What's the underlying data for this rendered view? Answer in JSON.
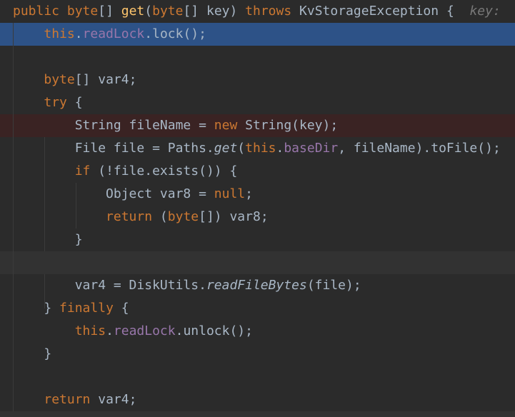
{
  "editor": {
    "lines": [
      {
        "indent": "",
        "tokens": [
          {
            "t": "public",
            "c": "kw"
          },
          {
            "t": " "
          },
          {
            "t": "byte",
            "c": "kw"
          },
          {
            "t": "[] "
          },
          {
            "t": "get",
            "c": "fn"
          },
          {
            "t": "("
          },
          {
            "t": "byte",
            "c": "kw"
          },
          {
            "t": "[] key) "
          },
          {
            "t": "throws",
            "c": "kw"
          },
          {
            "t": " KvStorageException {  "
          },
          {
            "t": "key:",
            "c": "hint"
          }
        ]
      },
      {
        "indent": "    ",
        "hl": "exec",
        "tokens": [
          {
            "t": "this",
            "c": "kw"
          },
          {
            "t": "."
          },
          {
            "t": "readLock",
            "c": "fld"
          },
          {
            "t": ".lock();"
          }
        ]
      },
      {
        "indent": "",
        "tokens": []
      },
      {
        "indent": "    ",
        "tokens": [
          {
            "t": "byte",
            "c": "kw"
          },
          {
            "t": "[] var4;"
          }
        ]
      },
      {
        "indent": "    ",
        "tokens": [
          {
            "t": "try",
            "c": "kw"
          },
          {
            "t": " {"
          }
        ]
      },
      {
        "indent": "        ",
        "hl": "bp",
        "tokens": [
          {
            "t": "String fileName = "
          },
          {
            "t": "new",
            "c": "kw"
          },
          {
            "t": " String(key);"
          }
        ]
      },
      {
        "indent": "        ",
        "tokens": [
          {
            "t": "File file = Paths."
          },
          {
            "t": "get",
            "c": "it"
          },
          {
            "t": "("
          },
          {
            "t": "this",
            "c": "kw"
          },
          {
            "t": "."
          },
          {
            "t": "baseDir",
            "c": "fld"
          },
          {
            "t": ", fileName).toFile();"
          }
        ]
      },
      {
        "indent": "        ",
        "tokens": [
          {
            "t": "if",
            "c": "kw"
          },
          {
            "t": " (!file.exists()) {"
          }
        ]
      },
      {
        "indent": "            ",
        "tokens": [
          {
            "t": "Object var8 = "
          },
          {
            "t": "null",
            "c": "kw"
          },
          {
            "t": ";"
          }
        ]
      },
      {
        "indent": "            ",
        "tokens": [
          {
            "t": "return",
            "c": "kw"
          },
          {
            "t": " ("
          },
          {
            "t": "byte",
            "c": "kw"
          },
          {
            "t": "[]) var8;"
          }
        ]
      },
      {
        "indent": "        ",
        "tokens": [
          {
            "t": "}"
          }
        ]
      },
      {
        "indent": "",
        "hl": "cur",
        "tokens": []
      },
      {
        "indent": "        ",
        "tokens": [
          {
            "t": "var4 = DiskUtils."
          },
          {
            "t": "readFileBytes",
            "c": "it"
          },
          {
            "t": "(file);"
          }
        ]
      },
      {
        "indent": "    ",
        "tokens": [
          {
            "t": "} "
          },
          {
            "t": "finally",
            "c": "kw"
          },
          {
            "t": " {"
          }
        ]
      },
      {
        "indent": "        ",
        "tokens": [
          {
            "t": "this",
            "c": "kw"
          },
          {
            "t": "."
          },
          {
            "t": "readLock",
            "c": "fld"
          },
          {
            "t": ".unlock();"
          }
        ]
      },
      {
        "indent": "    ",
        "tokens": [
          {
            "t": "}"
          }
        ]
      },
      {
        "indent": "",
        "tokens": []
      },
      {
        "indent": "    ",
        "tokens": [
          {
            "t": "return",
            "c": "kw"
          },
          {
            "t": " var4;"
          }
        ]
      }
    ]
  }
}
